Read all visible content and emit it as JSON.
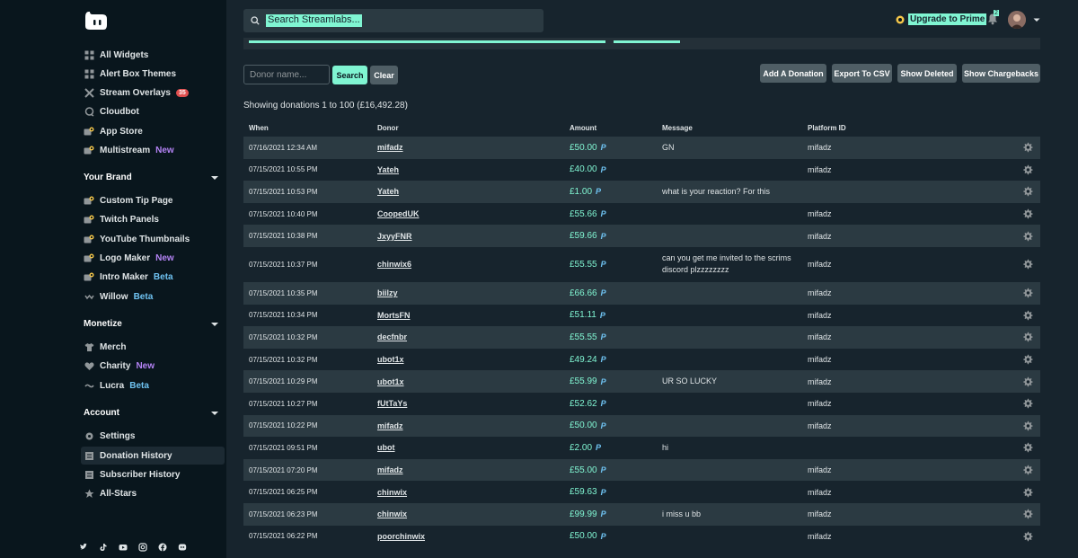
{
  "search": {
    "placeholder": "Search Streamlabs..."
  },
  "header": {
    "upgrade_label": "Upgrade to Prime",
    "notification_count": "2"
  },
  "sidebar": {
    "top_items": [
      {
        "label": "All Widgets",
        "icon": "grid-icon"
      },
      {
        "label": "Alert Box Themes",
        "icon": "grid-icon"
      },
      {
        "label": "Stream Overlays",
        "icon": "overlay-icon",
        "count": "35"
      },
      {
        "label": "Cloudbot",
        "icon": "chat-icon"
      },
      {
        "label": "App Store",
        "icon": "app-icon"
      },
      {
        "label": "Multistream",
        "icon": "multistream-icon",
        "tag": "New"
      }
    ],
    "your_brand": {
      "title": "Your Brand",
      "items": [
        {
          "label": "Custom Tip Page",
          "icon": "tip-page-icon"
        },
        {
          "label": "Twitch Panels",
          "icon": "panel-icon"
        },
        {
          "label": "YouTube Thumbnails",
          "icon": "thumbnail-icon"
        },
        {
          "label": "Logo Maker",
          "icon": "logo-icon",
          "tag": "New"
        },
        {
          "label": "Intro Maker",
          "icon": "intro-icon",
          "tag": "Beta"
        },
        {
          "label": "Willow",
          "icon": "willow-icon",
          "tag": "Beta"
        }
      ]
    },
    "monetize": {
      "title": "Monetize",
      "items": [
        {
          "label": "Merch",
          "icon": "shirt-icon"
        },
        {
          "label": "Charity",
          "icon": "heart-icon",
          "tag": "New"
        },
        {
          "label": "Lucra",
          "icon": "lucra-icon",
          "tag": "Beta"
        }
      ]
    },
    "account": {
      "title": "Account",
      "items": [
        {
          "label": "Settings",
          "icon": "gear-icon"
        },
        {
          "label": "Donation History",
          "icon": "list-icon"
        },
        {
          "label": "Subscriber History",
          "icon": "list-icon"
        },
        {
          "label": "All-Stars",
          "icon": "star-icon"
        }
      ]
    }
  },
  "filters": {
    "donor_placeholder": "Donor name...",
    "search_label": "Search",
    "clear_label": "Clear",
    "add_label": "Add A Donation",
    "export_label": "Export To CSV",
    "deleted_label": "Show Deleted",
    "chargebacks_label": "Show Chargebacks"
  },
  "summary": "Showing donations 1 to 100 (£16,492.28)",
  "table": {
    "headers": {
      "when": "When",
      "donor": "Donor",
      "amount": "Amount",
      "message": "Message",
      "platform": "Platform ID"
    },
    "rows": [
      {
        "when": "07/16/2021 12:34 AM",
        "donor": "mifadz",
        "amount": "£50.00",
        "message": "GN",
        "platform": "mifadz"
      },
      {
        "when": "07/15/2021 10:55 PM",
        "donor": "Yateh",
        "amount": "£40.00",
        "message": "",
        "platform": "mifadz"
      },
      {
        "when": "07/15/2021 10:53 PM",
        "donor": "Yateh",
        "amount": "£1.00",
        "message": "what is your reaction? For this",
        "platform": ""
      },
      {
        "when": "07/15/2021 10:40 PM",
        "donor": "CoopedUK",
        "amount": "£55.66",
        "message": "",
        "platform": "mifadz"
      },
      {
        "when": "07/15/2021 10:38 PM",
        "donor": "JxyyFNR",
        "amount": "£59.66",
        "message": "",
        "platform": "mifadz"
      },
      {
        "when": "07/15/2021 10:37 PM",
        "donor": "chinwix6",
        "amount": "£55.55",
        "message": "can you get me invited  to the scrims discord  plzzzzzzzz",
        "platform": "mifadz"
      },
      {
        "when": "07/15/2021 10:35 PM",
        "donor": "biilzy",
        "amount": "£66.66",
        "message": "",
        "platform": "mifadz"
      },
      {
        "when": "07/15/2021 10:34 PM",
        "donor": "MortsFN",
        "amount": "£51.11",
        "message": "",
        "platform": "mifadz"
      },
      {
        "when": "07/15/2021 10:32 PM",
        "donor": "decfnbr",
        "amount": "£55.55",
        "message": "",
        "platform": "mifadz"
      },
      {
        "when": "07/15/2021 10:32 PM",
        "donor": "ubot1x",
        "amount": "£49.24",
        "message": "",
        "platform": "mifadz"
      },
      {
        "when": "07/15/2021 10:29 PM",
        "donor": "ubot1x",
        "amount": "£55.99",
        "message": "UR SO LUCKY",
        "platform": "mifadz"
      },
      {
        "when": "07/15/2021 10:27 PM",
        "donor": "fUtTaYs",
        "amount": "£52.62",
        "message": "",
        "platform": "mifadz"
      },
      {
        "when": "07/15/2021 10:22 PM",
        "donor": "mifadz",
        "amount": "£50.00",
        "message": "",
        "platform": "mifadz"
      },
      {
        "when": "07/15/2021 09:51 PM",
        "donor": "ubot",
        "amount": "£2.00",
        "message": "hi",
        "platform": ""
      },
      {
        "when": "07/15/2021 07:20 PM",
        "donor": "mifadz",
        "amount": "£55.00",
        "message": "",
        "platform": "mifadz"
      },
      {
        "when": "07/15/2021 06:25 PM",
        "donor": "chinwix",
        "amount": "£59.63",
        "message": "",
        "platform": "mifadz"
      },
      {
        "when": "07/15/2021 06:23 PM",
        "donor": "chinwix",
        "amount": "£99.99",
        "message": "i miss u bb",
        "platform": "mifadz"
      },
      {
        "when": "07/15/2021 06:22 PM",
        "donor": "poorchinwix",
        "amount": "£50.00",
        "message": "",
        "platform": "mifadz"
      }
    ]
  }
}
